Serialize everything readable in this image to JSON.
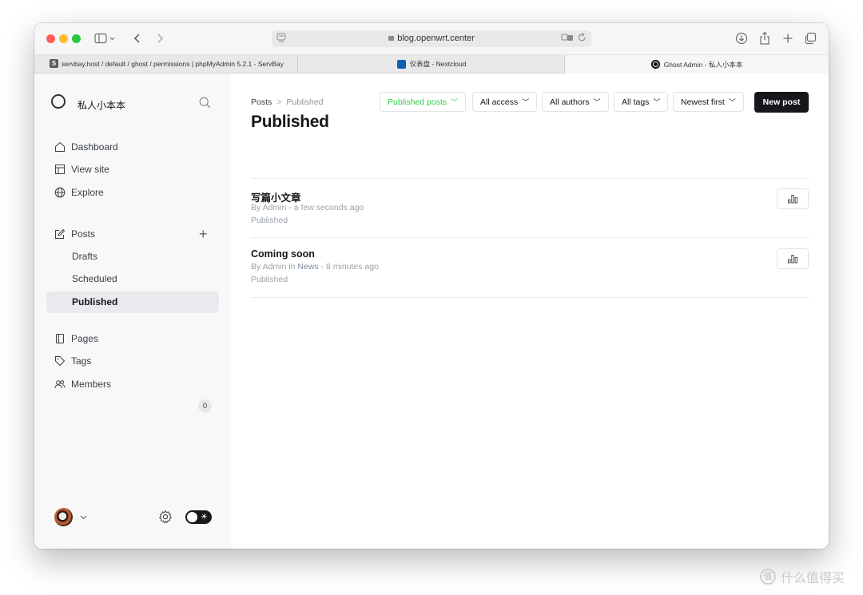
{
  "browser": {
    "url": "blog.openwrt.center",
    "tabs": [
      {
        "label": "servbay.host / default / ghost / permissions | phpMyAdmin 5.2.1 - ServBay",
        "favicon": "S"
      },
      {
        "label": "仪表盘 - Nextcloud"
      },
      {
        "label": "Ghost Admin - 私人小本本"
      }
    ]
  },
  "sidebar": {
    "site_name": "私人小本本",
    "nav": [
      {
        "label": "Dashboard",
        "icon": "home-icon"
      },
      {
        "label": "View site",
        "icon": "layout-icon"
      },
      {
        "label": "Explore",
        "icon": "globe-icon"
      }
    ],
    "posts": {
      "label": "Posts",
      "sub": [
        "Drafts",
        "Scheduled",
        "Published"
      ],
      "active": "Published"
    },
    "more": [
      {
        "label": "Pages",
        "icon": "pages-icon"
      },
      {
        "label": "Tags",
        "icon": "tag-icon"
      },
      {
        "label": "Members",
        "icon": "members-icon",
        "count": "0"
      }
    ]
  },
  "main": {
    "breadcrumb": {
      "parent": "Posts",
      "current": "Published"
    },
    "title": "Published",
    "filters": [
      "Published posts",
      "All access",
      "All authors",
      "All tags",
      "Newest first"
    ],
    "new_post": "New post",
    "posts": [
      {
        "title": "写篇小文章",
        "by": "By Admin",
        "in": "",
        "time": "a few seconds ago",
        "status": "Published"
      },
      {
        "title": "Coming soon",
        "by": "By Admin",
        "in": "News",
        "time": "8 minutes ago",
        "status": "Published"
      }
    ]
  },
  "watermark": {
    "text": "什么值得买",
    "badge": "值"
  },
  "colors": {
    "accent_green": "#30cf43",
    "primary_dark": "#15171a"
  }
}
